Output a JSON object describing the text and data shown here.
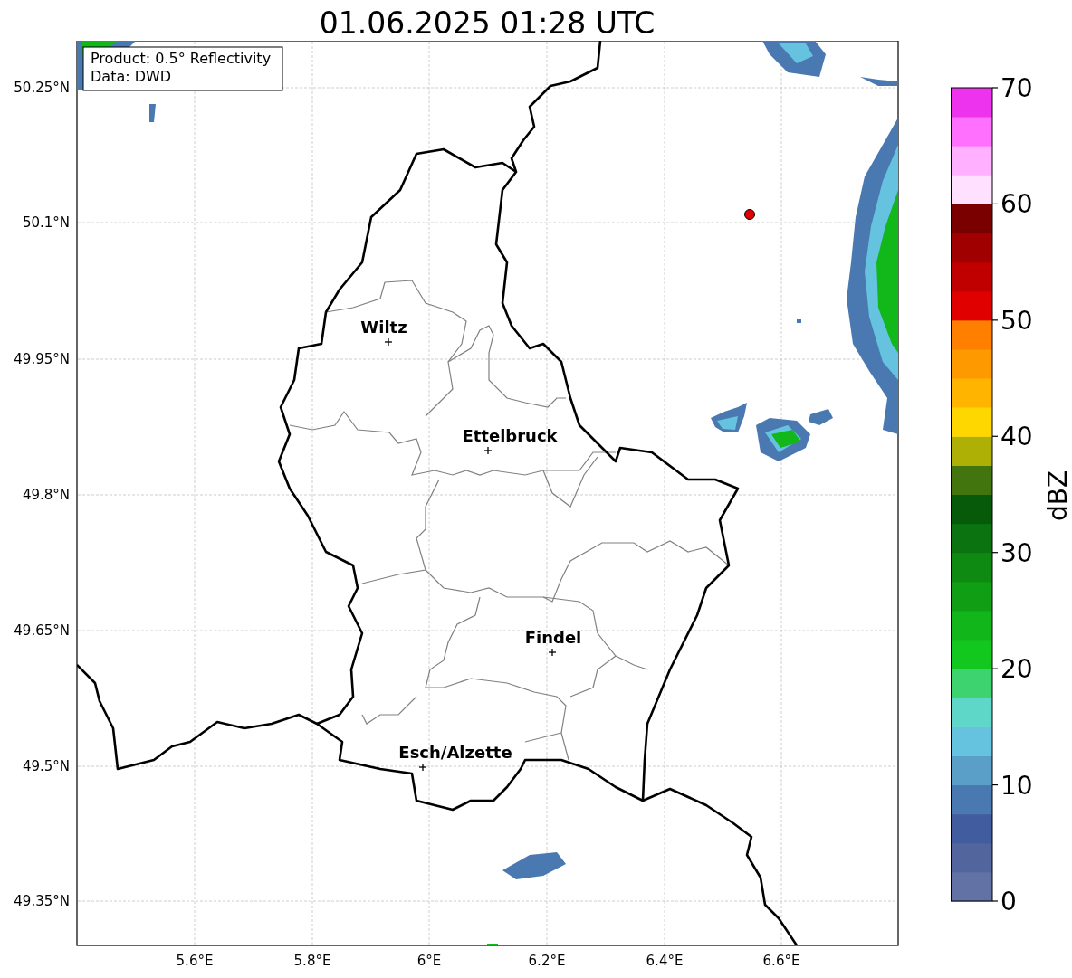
{
  "title": "01.06.2025 01:28 UTC",
  "info_box": [
    "Product: 0.5° Reflectivity",
    "Data: DWD"
  ],
  "lat_ticks": [
    "50.25°N",
    "50.1°N",
    "49.95°N",
    "49.8°N",
    "49.65°N",
    "49.5°N",
    "49.35°N"
  ],
  "lon_ticks": [
    "5.6°E",
    "5.8°E",
    "6°E",
    "6.2°E",
    "6.4°E",
    "6.6°E"
  ],
  "cities": [
    {
      "name": "Wiltz"
    },
    {
      "name": "Ettelbruck"
    },
    {
      "name": "Findel"
    },
    {
      "name": "Esch/Alzette"
    }
  ],
  "colorbar": {
    "label": "dBZ",
    "ticks": [
      "70",
      "60",
      "50",
      "40",
      "30",
      "20",
      "10",
      "0"
    ],
    "bins": [
      {
        "color": "#6272a4"
      },
      {
        "color": "#52659c"
      },
      {
        "color": "#425ca0"
      },
      {
        "color": "#4a78b0"
      },
      {
        "color": "#5a9fc8"
      },
      {
        "color": "#66c3e0"
      },
      {
        "color": "#5ed6c8"
      },
      {
        "color": "#3dd36f"
      },
      {
        "color": "#12c71e"
      },
      {
        "color": "#11b71a"
      },
      {
        "color": "#109e14"
      },
      {
        "color": "#0e8a12"
      },
      {
        "color": "#0b7410"
      },
      {
        "color": "#075a0a"
      },
      {
        "color": "#43750e"
      },
      {
        "color": "#afb006"
      },
      {
        "color": "#ffd700"
      },
      {
        "color": "#ffb400"
      },
      {
        "color": "#ff9900"
      },
      {
        "color": "#ff7f00"
      },
      {
        "color": "#e10000"
      },
      {
        "color": "#c00000"
      },
      {
        "color": "#a00000"
      },
      {
        "color": "#7a0000"
      },
      {
        "color": "#ffe0ff"
      },
      {
        "color": "#ffb0ff"
      },
      {
        "color": "#ff70ff"
      },
      {
        "color": "#ee33ee"
      }
    ]
  }
}
